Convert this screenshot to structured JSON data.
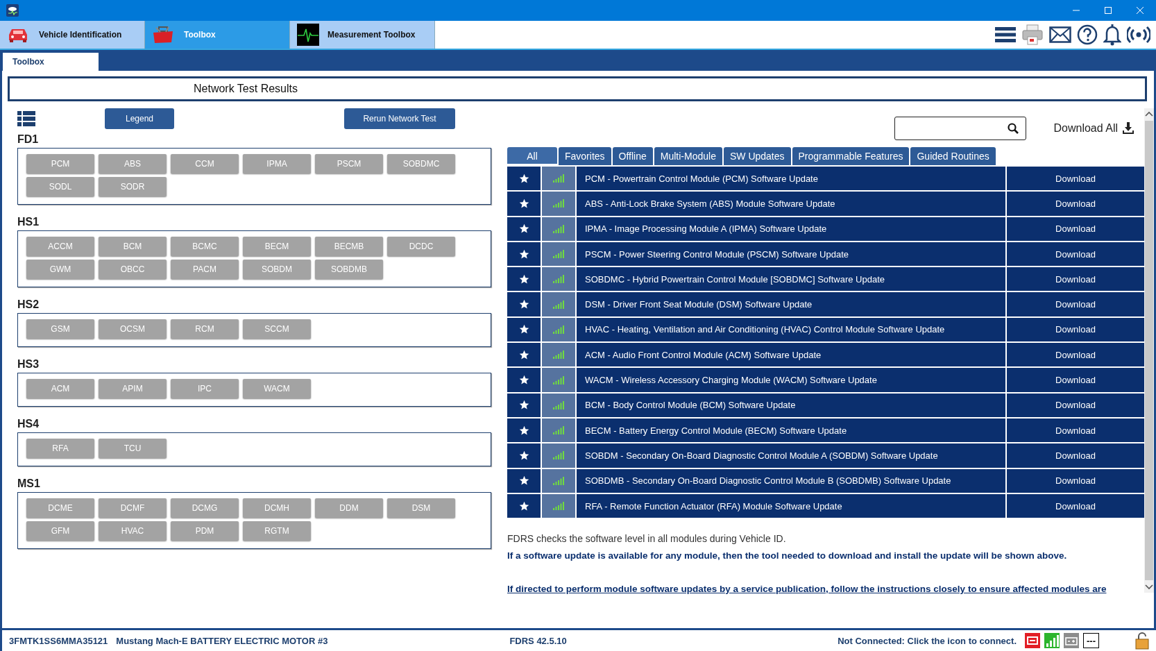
{
  "app_tabs": [
    {
      "label": "Vehicle Identification",
      "kind": "car",
      "selected": false
    },
    {
      "label": "Toolbox",
      "kind": "toolbox",
      "selected": true
    },
    {
      "label": "Measurement Toolbox",
      "kind": "wave",
      "selected": false
    }
  ],
  "sub_tabs": [
    {
      "label": "Toolbox",
      "selected": true
    }
  ],
  "header": "Network Test Results",
  "legend_button": "Legend",
  "rerun_button": "Rerun Network Test",
  "networks": [
    {
      "name": "FD1",
      "modules": [
        "PCM",
        "ABS",
        "CCM",
        "IPMA",
        "PSCM",
        "SOBDMC",
        "SODL",
        "SODR"
      ]
    },
    {
      "name": "HS1",
      "modules": [
        "ACCM",
        "BCM",
        "BCMC",
        "BECM",
        "BECMB",
        "DCDC",
        "GWM",
        "OBCC",
        "PACM",
        "SOBDM",
        "SOBDMB"
      ]
    },
    {
      "name": "HS2",
      "modules": [
        "GSM",
        "OCSM",
        "RCM",
        "SCCM"
      ]
    },
    {
      "name": "HS3",
      "modules": [
        "ACM",
        "APIM",
        "IPC",
        "WACM"
      ]
    },
    {
      "name": "HS4",
      "modules": [
        "RFA",
        "TCU"
      ]
    },
    {
      "name": "MS1",
      "modules": [
        "DCME",
        "DCMF",
        "DCMG",
        "DCMH",
        "DDM",
        "DSM",
        "GFM",
        "HVAC",
        "PDM",
        "RGTM"
      ]
    }
  ],
  "download_all": "Download All",
  "filter_tabs": [
    {
      "label": "All",
      "selected": true
    },
    {
      "label": "Favorites",
      "selected": false
    },
    {
      "label": "Offline",
      "selected": false
    },
    {
      "label": "Multi-Module",
      "selected": false
    },
    {
      "label": "SW Updates",
      "selected": false
    },
    {
      "label": "Programmable Features",
      "selected": false
    },
    {
      "label": "Guided Routines",
      "selected": false
    }
  ],
  "routines": [
    {
      "title": "PCM - Powertrain Control Module (PCM) Software Update",
      "action": "Download"
    },
    {
      "title": "ABS - Anti-Lock Brake System (ABS) Module Software Update",
      "action": "Download"
    },
    {
      "title": "IPMA - Image Processing Module A (IPMA) Software Update",
      "action": "Download"
    },
    {
      "title": "PSCM - Power Steering Control Module (PSCM) Software Update",
      "action": "Download"
    },
    {
      "title": "SOBDMC - Hybrid Powertrain Control Module [SOBDMC] Software Update",
      "action": "Download"
    },
    {
      "title": "DSM - Driver Front Seat Module (DSM) Software Update",
      "action": "Download"
    },
    {
      "title": "HVAC - Heating, Ventilation and Air Conditioning (HVAC) Control Module Software Update",
      "action": "Download"
    },
    {
      "title": "ACM - Audio Front Control Module (ACM) Software Update",
      "action": "Download"
    },
    {
      "title": "WACM - Wireless Accessory Charging Module (WACM) Software Update",
      "action": "Download"
    },
    {
      "title": "BCM - Body Control Module (BCM) Software Update",
      "action": "Download"
    },
    {
      "title": "BECM - Battery Energy Control Module (BECM) Software Update",
      "action": "Download"
    },
    {
      "title": "SOBDM - Secondary On-Board Diagnostic Control Module A (SOBDM) Software Update",
      "action": "Download"
    },
    {
      "title": "SOBDMB - Secondary On-Board Diagnostic Control Module B (SOBDMB) Software Update",
      "action": "Download"
    },
    {
      "title": "RFA - Remote Function Actuator (RFA) Module Software Update",
      "action": "Download"
    }
  ],
  "info_text": "FDRS checks the software level in all modules during Vehicle ID.",
  "info_bold": "If a software update is available for any module, then the tool needed to download and install the update will be shown above.",
  "info_link": "If directed to perform module software updates by a service publication, follow the instructions closely to ensure affected modules are",
  "status_bar": {
    "vin": "3FMTK1SS6MMA35121",
    "vehicle": "Mustang Mach-E BATTERY ELECTRIC MOTOR #3",
    "version": "FDRS 42.5.10",
    "connection": "Not Connected: Click the icon to connect.",
    "dash": "---"
  }
}
